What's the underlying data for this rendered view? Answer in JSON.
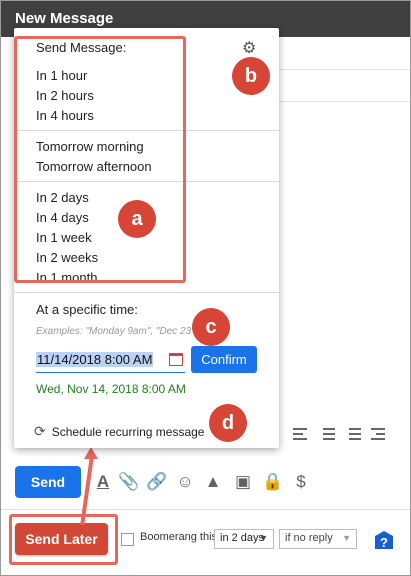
{
  "window": {
    "title": "New Message"
  },
  "popup": {
    "heading": "Send Message:",
    "group1": [
      "In 1 hour",
      "In 2 hours",
      "In 4 hours"
    ],
    "group2": [
      "Tomorrow morning",
      "Tomorrow afternoon"
    ],
    "group3": [
      "In 2 days",
      "In 4 days",
      "In 1 week",
      "In 2 weeks",
      "In 1 month"
    ],
    "specific_label": "At a specific time:",
    "examples": "Examples: \"Monday 9am\", \"Dec 23\"",
    "datetime_value": "11/14/2018 8:00 AM",
    "confirm_label": "Confirm",
    "parsed_date": "Wed, Nov 14, 2018 8:00 AM",
    "recurring_label": "Schedule recurring message"
  },
  "annotations": {
    "a": "a",
    "b": "b",
    "c": "c",
    "d": "d"
  },
  "toolbar": {
    "send_label": "Send",
    "dollar": "$"
  },
  "footer": {
    "send_later_label": "Send Later",
    "boomerang_label": "Boomerang this",
    "delay_value": "in 2 days",
    "reply_value": "if no reply",
    "help_symbol": "?"
  },
  "colors": {
    "accent": "#1a73e8",
    "send_later": "#d14836",
    "annotation": "#e8675a",
    "parsed": "#1e7e1e"
  }
}
